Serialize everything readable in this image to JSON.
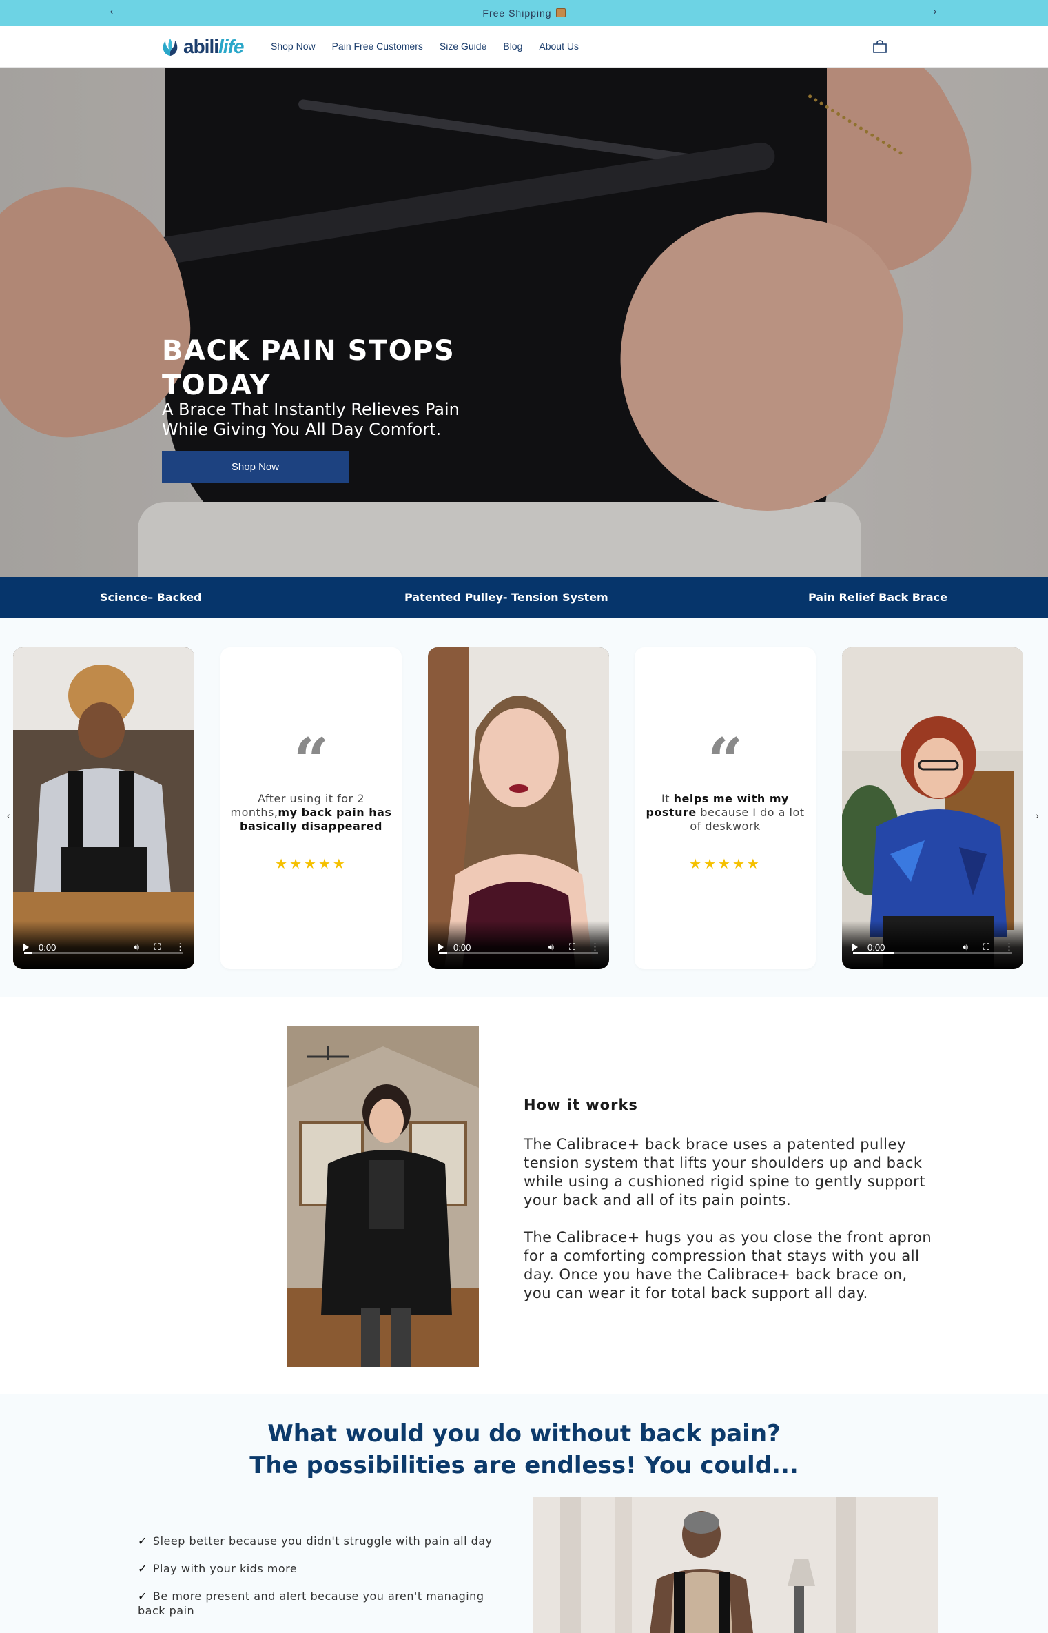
{
  "announcement": {
    "text": "Free Shipping",
    "prev_arrow": "‹",
    "next_arrow": "›"
  },
  "nav": {
    "logo": {
      "part1": "abili",
      "part2": "life"
    },
    "links": [
      "Shop Now",
      "Pain Free Customers",
      "Size Guide",
      "Blog",
      "About Us"
    ]
  },
  "hero": {
    "title": "BACK PAIN STOPS TODAY",
    "subtitle": "A Brace That Instantly Relieves Pain While Giving You All Day Comfort.",
    "button": "Shop Now"
  },
  "features": [
    "Science– Backed",
    "Patented Pulley- Tension System",
    "Pain Relief Back Brace"
  ],
  "reviews": {
    "prev_arrow": "‹",
    "next_arrow": "›",
    "video_time": "0:00",
    "quote_mark": "“",
    "stars": "★★★★★",
    "quote1": {
      "pre": "After using it for 2 months,",
      "bold": "my back pain has basically disappeared",
      "post": ""
    },
    "quote2": {
      "pre": "It ",
      "bold": "helps me with my posture",
      "post": " because I do a lot of deskwork"
    }
  },
  "how": {
    "title": "How it works",
    "p1": "The Calibrace+ back brace uses a patented pulley tension system that lifts your shoulders up and back while using a cushioned rigid spine to gently support your back and all of its pain points.",
    "p2": "The Calibrace+ hugs you as you close the front apron for a comforting compression that stays with you all day. Once you have the Calibrace+ back brace on, you can wear it for total back support all day."
  },
  "possibilities": {
    "title_line1": "What would you do without back pain?",
    "title_line2": "The possibilities are endless! You could...",
    "check": "✓",
    "items": [
      "Sleep better because you didn't struggle with pain all day",
      "Play with your kids more",
      "Be more present and alert because you aren't managing back pain"
    ]
  },
  "colors": {
    "announcement_bg": "#6dd3e4",
    "primary_navy": "#06356b",
    "button_blue": "#1d4280",
    "star_yellow": "#f5c000",
    "logo_teal": "#2aa7c9"
  }
}
